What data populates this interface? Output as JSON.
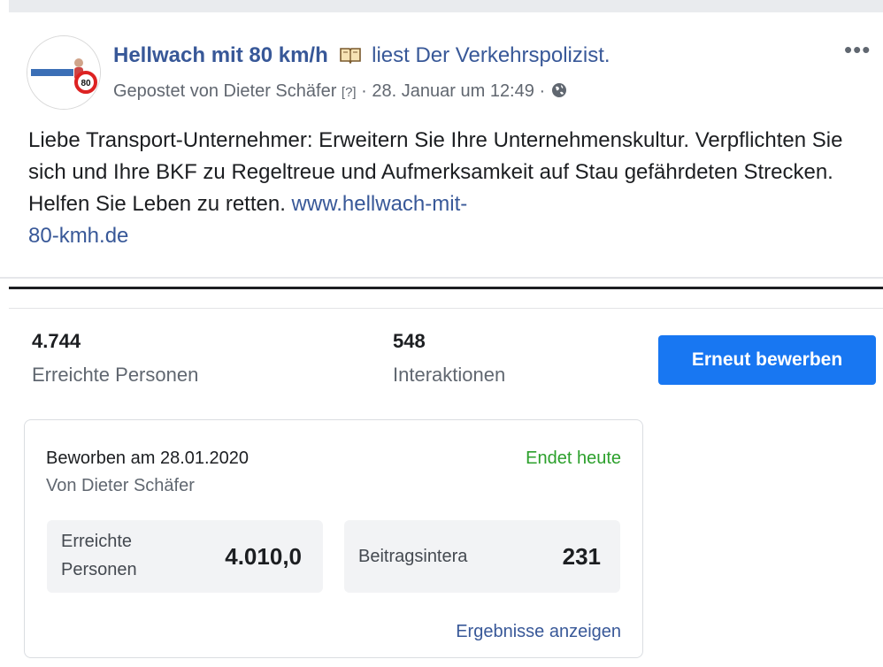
{
  "post": {
    "page_name": "Hellwach mit 80 km/h",
    "activity_icon": "open-book-icon",
    "activity": "liest Der Verkehrspolizist.",
    "posted_by": "Gepostet von Dieter Schäfer",
    "posted_by_help": "[?]",
    "separator": "·",
    "date": "28. Januar um 12:49",
    "privacy_icon": "globe-icon",
    "more_icon": "more-options-icon",
    "more_label": "•••",
    "text": "Liebe Transport-Unternehmer: Erweitern Sie Ihre Unternehmenskultur. Verpflichten Sie sich und Ihre BKF zu Regeltreue und Aufmerksamkeit auf Stau gefährdeten Strecken. Helfen Sie Leben zu retten.",
    "link": "www.hellwach-mit-80-kmh.de",
    "link_line1": "www.hellwach-mit-",
    "link_line2": "80-kmh.de"
  },
  "stats": {
    "reach_value": "4.744",
    "reach_label": "Erreichte Personen",
    "interactions_value": "548",
    "interactions_label": "Interaktionen",
    "boost_button": "Erneut bewerben"
  },
  "promotion": {
    "title": "Beworben am 28.01.2020",
    "by": "Von Dieter Schäfer",
    "status": "Endet heute",
    "status_color": "#2ca02c",
    "reach_label_line1": "Erreichte",
    "reach_label_line2": "Personen",
    "reach_value": "4.010,0",
    "interactions_label": "Beitragsintera",
    "interactions_value": "231",
    "results_link": "Ergebnisse anzeigen"
  },
  "colors": {
    "link": "#385898",
    "button": "#1877f2"
  }
}
